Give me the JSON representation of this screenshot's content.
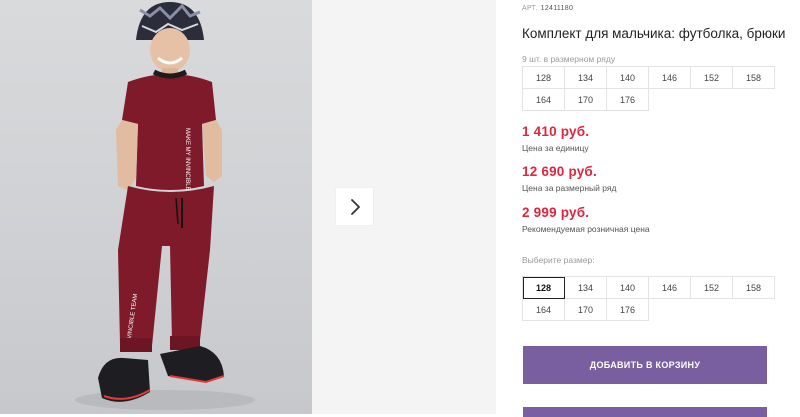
{
  "product": {
    "art_label": "АРТ.",
    "art_number": "12411180",
    "title": "Комплект для мальчика: футболка, брюки"
  },
  "pack": {
    "note": "9 шт. в размерном ряду",
    "sizes": [
      "128",
      "134",
      "140",
      "146",
      "152",
      "158",
      "164",
      "170",
      "176"
    ]
  },
  "prices": {
    "unit": {
      "value": "1 410 руб.",
      "label": "Цена за единицу"
    },
    "pack": {
      "value": "12 690 руб.",
      "label": "Цена за размерный ряд"
    },
    "retail": {
      "value": "2 999 руб.",
      "label": "Рекомендуемая розничная цена"
    }
  },
  "size_select": {
    "label": "Выберите размер:",
    "sizes": [
      "128",
      "134",
      "140",
      "146",
      "152",
      "158",
      "164",
      "170",
      "176"
    ],
    "selected": "128"
  },
  "actions": {
    "add_to_cart": "ДОБАВИТЬ В КОРЗИНУ"
  },
  "colors": {
    "price": "#e0253e",
    "button": "#7a5fa0",
    "outfit": "#7e1a2a"
  },
  "icons": {
    "next": "chevron-right-icon"
  },
  "outfit_prints": {
    "shirt_print": "MAKE MY INVINCIBLE",
    "pants_print": "INVINCIBLE TEAM"
  }
}
